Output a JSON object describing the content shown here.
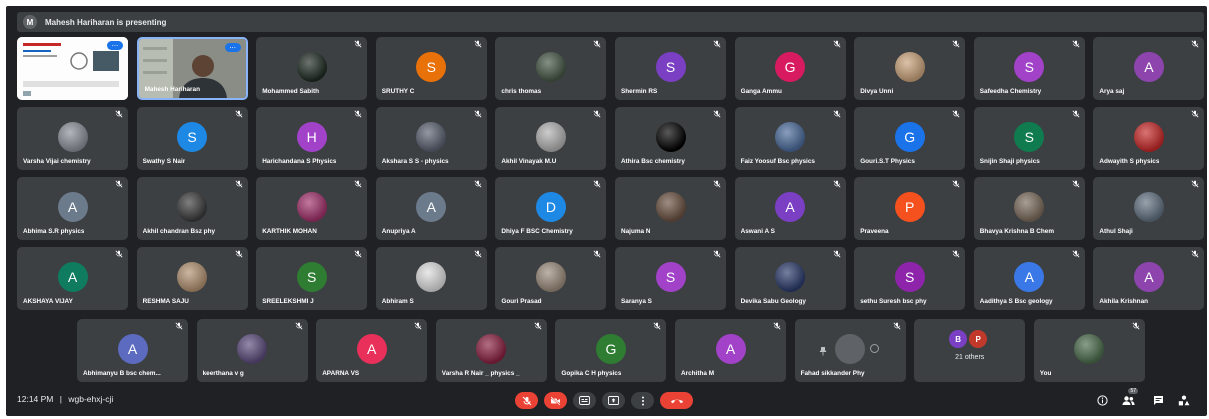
{
  "banner": {
    "initial": "M",
    "text": "Mahesh Hariharan is presenting"
  },
  "rows": [
    [
      {
        "kind": "screen",
        "name": "",
        "label": ""
      },
      {
        "kind": "video",
        "name": "Mahesh Hariharan",
        "active": true
      },
      {
        "kind": "photo",
        "name": "Mohammed Sabith",
        "color": "#1f2a22"
      },
      {
        "kind": "letter",
        "name": "SRUTHY C",
        "letter": "S",
        "color": "#e8710a"
      },
      {
        "kind": "photo",
        "name": "chris thomas",
        "color": "#445544"
      },
      {
        "kind": "letter",
        "name": "Shermin RS",
        "letter": "S",
        "color": "#7b3fc4"
      },
      {
        "kind": "letter",
        "name": "Ganga Ammu",
        "letter": "G",
        "color": "#d81b60"
      },
      {
        "kind": "photo",
        "name": "Divya Unni",
        "color": "#c9a27a"
      },
      {
        "kind": "letter",
        "name": "Safeedha Chemistry",
        "letter": "S",
        "color": "#a142c9"
      },
      {
        "kind": "letter",
        "name": "Arya saj",
        "letter": "A",
        "color": "#8e44ad"
      }
    ],
    [
      {
        "kind": "photo",
        "name": "Varsha Vijai chemistry",
        "color": "#8a8f98"
      },
      {
        "kind": "letter",
        "name": "Swathy S Nair",
        "letter": "S",
        "color": "#1e88e5"
      },
      {
        "kind": "letter",
        "name": "Harichandana S Physics",
        "letter": "H",
        "color": "#a142c9"
      },
      {
        "kind": "photo",
        "name": "Akshara S S - physics",
        "color": "#5a6070"
      },
      {
        "kind": "photo",
        "name": "Akhil Vinayak M.U",
        "color": "#b0b0b0"
      },
      {
        "kind": "photo",
        "name": "Athira Bsc chemistry",
        "color": "#000000"
      },
      {
        "kind": "photo",
        "name": "Faiz Yoosuf Bsc physics",
        "color": "#4a6a9a"
      },
      {
        "kind": "letter",
        "name": "Gouri.S.T Physics",
        "letter": "G",
        "color": "#1a73e8"
      },
      {
        "kind": "letter",
        "name": "Snijin Shaji physics",
        "letter": "S",
        "color": "#0f7b4f"
      },
      {
        "kind": "photo",
        "name": "Adwayith S physics",
        "color": "#c62828"
      }
    ],
    [
      {
        "kind": "letter",
        "name": "Abhima S.R physics",
        "letter": "A",
        "color": "#6b7b8c"
      },
      {
        "kind": "photo",
        "name": "Akhil chandran Bsz phy",
        "color": "#3a3a3a"
      },
      {
        "kind": "photo",
        "name": "KARTHIK MOHAN",
        "color": "#a0306a"
      },
      {
        "kind": "letter",
        "name": "Anupriya A",
        "letter": "A",
        "color": "#6b7b8c"
      },
      {
        "kind": "letter",
        "name": "Dhiya F BSC Chemistry",
        "letter": "D",
        "color": "#1e88e5"
      },
      {
        "kind": "photo",
        "name": "Najuma N",
        "color": "#6a5040"
      },
      {
        "kind": "letter",
        "name": "Aswani A S",
        "letter": "A",
        "color": "#7b3fc4"
      },
      {
        "kind": "letter",
        "name": "Praveena",
        "letter": "P",
        "color": "#f4511e"
      },
      {
        "kind": "photo",
        "name": "Bhavya Krishna B Chem",
        "color": "#7a6a5a"
      },
      {
        "kind": "photo",
        "name": "Athul Shaji",
        "color": "#607080"
      }
    ],
    [
      {
        "kind": "letter",
        "name": "AKSHAYA VIJAY",
        "letter": "A",
        "color": "#0f7b5f"
      },
      {
        "kind": "photo",
        "name": "RESHMA SAJU",
        "color": "#b09070"
      },
      {
        "kind": "letter",
        "name": "SREELEKSHMI J",
        "letter": "S",
        "color": "#2e7d32"
      },
      {
        "kind": "photo",
        "name": "Abhiram S",
        "color": "#dddddd"
      },
      {
        "kind": "photo",
        "name": "Gouri Prasad",
        "color": "#9a8a7a"
      },
      {
        "kind": "letter",
        "name": "Saranya S",
        "letter": "S",
        "color": "#a142c9"
      },
      {
        "kind": "photo",
        "name": "Devika Sabu Geology",
        "color": "#2a3a6a"
      },
      {
        "kind": "letter",
        "name": "sethu Suresh bsc phy",
        "letter": "S",
        "color": "#8e24aa"
      },
      {
        "kind": "letter",
        "name": "Aadithya S Bsc geology",
        "letter": "A",
        "color": "#3b78e7"
      },
      {
        "kind": "letter",
        "name": "Akhila Krishnan",
        "letter": "A",
        "color": "#8e44ad"
      }
    ],
    [
      {
        "kind": "letter",
        "name": "Abhimanyu B bsc chem...",
        "letter": "A",
        "color": "#5c6bc0"
      },
      {
        "kind": "photo",
        "name": "keerthana v g",
        "color": "#5a4a7a"
      },
      {
        "kind": "letter",
        "name": "APARNA VS",
        "letter": "A",
        "color": "#e8305a"
      },
      {
        "kind": "photo",
        "name": "Varsha R Nair _ physics _",
        "color": "#8a2040"
      },
      {
        "kind": "letter",
        "name": "Gopika C H physics",
        "letter": "G",
        "color": "#2e7d32"
      },
      {
        "kind": "letter",
        "name": "Architha M",
        "letter": "A",
        "color": "#a142c9"
      },
      {
        "kind": "pinned",
        "name": "Fahad sikkander Phy"
      },
      {
        "kind": "others",
        "name": "21 others",
        "a": "B",
        "b": "P",
        "aColor": "#7b3fc4",
        "bColor": "#c0392b"
      },
      {
        "kind": "photo",
        "name": "You",
        "color": "#4a6a4a"
      }
    ]
  ],
  "bottom": {
    "time": "12:14 PM",
    "separator": "|",
    "code": "wgb-ehxj-cji",
    "people_count": "57"
  },
  "colors": {
    "bg": "#202124",
    "tile": "#3c4043",
    "red": "#ea4335",
    "ctrl": "#3c4043",
    "accent": "#1a73e8"
  },
  "controls": [
    "mic-off",
    "camera-off",
    "captions",
    "present",
    "more-options",
    "leave-call"
  ],
  "right_icons": [
    "info-icon",
    "people-icon",
    "chat-icon",
    "activities-icon"
  ]
}
